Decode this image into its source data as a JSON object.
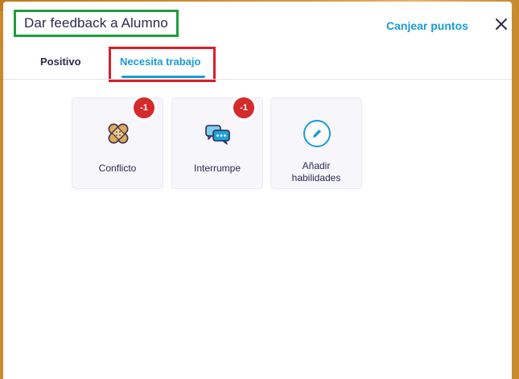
{
  "modal": {
    "title": "Dar feedback a Alumno",
    "redeem_label": "Canjear puntos",
    "close_glyph": "✕"
  },
  "tabs": [
    {
      "label": "Positivo",
      "active": false
    },
    {
      "label": "Necesita trabajo",
      "active": true
    }
  ],
  "skills": [
    {
      "label": "Conflicto",
      "badge": "-1",
      "icon": "bandage-icon"
    },
    {
      "label": "Interrumpe",
      "badge": "-1",
      "icon": "chat-bubbles-icon"
    },
    {
      "label": "Añadir habilidades",
      "badge": null,
      "icon": "edit-pencil-icon"
    }
  ],
  "colors": {
    "accent": "#1a9bd7",
    "badge": "#d52b2b",
    "title_highlight": "#1f9e3a",
    "tab_highlight": "#d61f2b",
    "background": "#c98a2e"
  }
}
